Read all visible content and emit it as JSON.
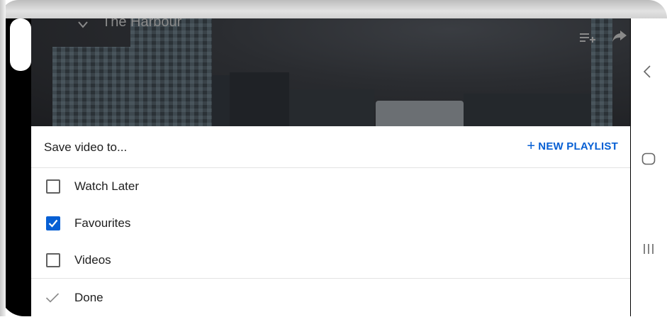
{
  "video": {
    "title": "The Harbour"
  },
  "sheet": {
    "title": "Save video to...",
    "new_playlist_label": "NEW PLAYLIST",
    "new_playlist_plus": "+",
    "playlists": [
      {
        "label": "Watch Later",
        "checked": false
      },
      {
        "label": "Favourites",
        "checked": true
      },
      {
        "label": "Videos",
        "checked": false
      }
    ],
    "done_label": "Done"
  },
  "colors": {
    "accent": "#065fd4",
    "text": "#202020",
    "divider": "#e3e3e3"
  },
  "icons": {
    "video_top_left": "chevron-down-icon",
    "add_to_queue": "add-to-queue-icon",
    "share": "share-icon",
    "done": "check-icon",
    "nav_back": "back-icon",
    "nav_home": "home-icon",
    "nav_recents": "recents-icon"
  }
}
